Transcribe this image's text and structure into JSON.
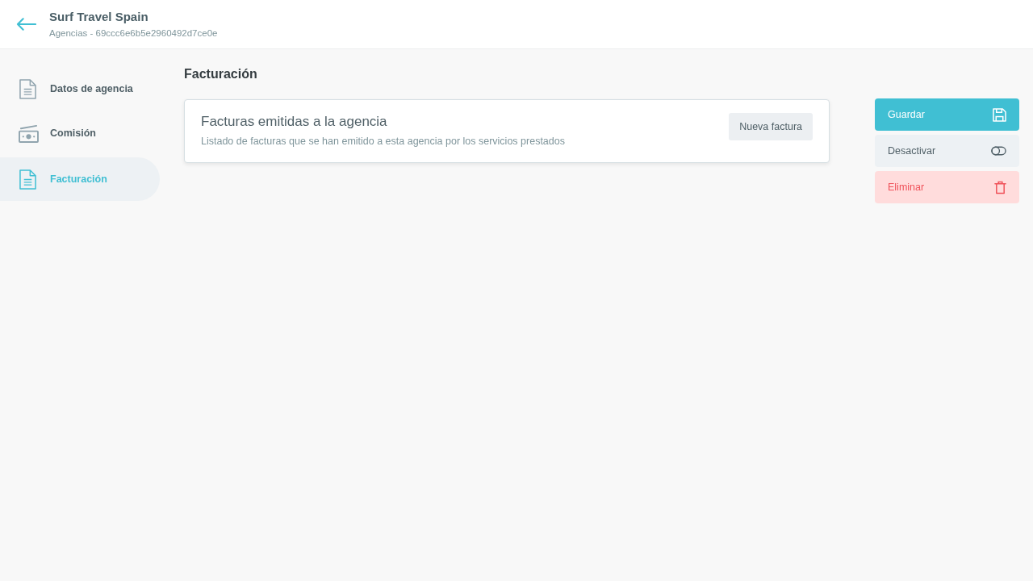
{
  "header": {
    "title": "Surf Travel Spain",
    "subtitle": "Agencias - 69ccc6e6b5e2960492d7ce0e"
  },
  "sidebar": {
    "items": [
      {
        "label": "Datos de agencia",
        "selected": false
      },
      {
        "label": "Comisión",
        "selected": false
      },
      {
        "label": "Facturación",
        "selected": true
      }
    ]
  },
  "main": {
    "title": "Facturación",
    "card": {
      "title": "Facturas emitidas a la agencia",
      "description": "Listado de facturas que se han emitido a esta agencia por los servicios prestados",
      "button": "Nueva factura"
    }
  },
  "actions": [
    {
      "label": "Guardar",
      "kind": "primary"
    },
    {
      "label": "Desactivar",
      "kind": "secondary"
    },
    {
      "label": "Eliminar",
      "kind": "danger"
    }
  ]
}
